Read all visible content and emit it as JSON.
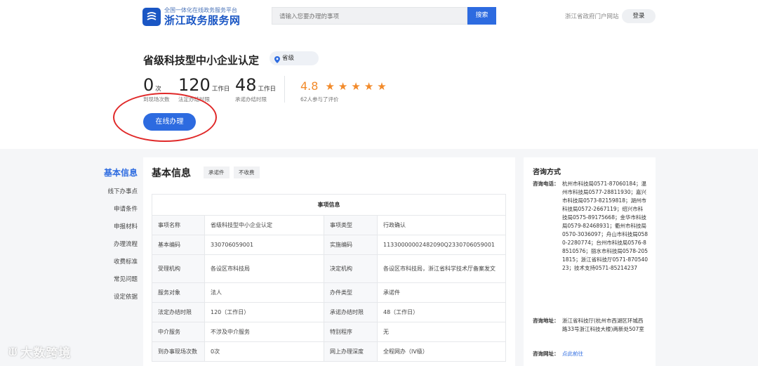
{
  "header": {
    "logo_subtitle": "全国一体化在线政务服务平台",
    "logo_title": "浙江政务服务网",
    "search_placeholder": "请输入您要办理的事项",
    "search_button": "搜索",
    "gov_portal_link": "浙江省政府门户网站",
    "login_button": "登录"
  },
  "item": {
    "title": "省级科技型中小企业认定",
    "level": "省级",
    "stats": [
      {
        "num": "0",
        "unit": "次",
        "label": "到现场次数"
      },
      {
        "num": "120",
        "unit": "工作日",
        "label": "法定办结时限"
      },
      {
        "num": "48",
        "unit": "工作日",
        "label": "承诺办结时限"
      }
    ],
    "rating": {
      "score": "4.8",
      "stars": 5,
      "count_label": "62人参与了评价"
    },
    "online_button": "在线办理"
  },
  "nav": {
    "items": [
      {
        "label": "基本信息",
        "active": true
      },
      {
        "label": "线下办事点"
      },
      {
        "label": "申请条件"
      },
      {
        "label": "申报材料"
      },
      {
        "label": "办理流程"
      },
      {
        "label": "收费标准"
      },
      {
        "label": "常见问题"
      },
      {
        "label": "设定依据"
      }
    ]
  },
  "basic_info": {
    "title": "基本信息",
    "tags": [
      "承诺件",
      "不收费"
    ],
    "table_header": "事项信息",
    "rows": [
      [
        "事项名称",
        "省级科技型中小企业认定",
        "事项类型",
        "行政确认"
      ],
      [
        "基本编码",
        "330706059001",
        "实施编码",
        "11330000002482090Q2330706059001"
      ],
      [
        "受理机构",
        "各设区市科技局",
        "决定机构",
        "各设区市科技局，浙江省科学技术厅备案发文"
      ],
      [
        "服务对象",
        "法人",
        "办件类型",
        "承诺件"
      ],
      [
        "法定办结时限",
        "120（工作日）",
        "承诺办结时限",
        "48（工作日）"
      ],
      [
        "中介服务",
        "不涉及中介服务",
        "特别程序",
        "无"
      ],
      [
        "到办事现场次数",
        "0次",
        "网上办理深度",
        "全程网办（IV级）"
      ]
    ]
  },
  "consult": {
    "title": "咨询方式",
    "phone_label": "咨询电话：",
    "phone_value": "杭州市科技局0571-87060184；温州市科技局0577-28811930；嘉兴市科技局0573-82159818；湖州市科技局0572-2667119；绍兴市科技局0575-89175668；金华市科技局0579-82468931；衢州市科技局0570-3036097；舟山市科技局0580-2280774；台州市科技局0576-88510576；丽水市科技局0578-2051815；浙江省科技厅0571-87054023；技术支持0571-85214237",
    "address_label": "咨询地址：",
    "address_value": "浙江省科技厅(杭州市西湖区环城西路33号浙江科技大楼)两新处507室",
    "website_label": "咨询网址：",
    "website_value": "点此前往"
  },
  "watermark": "大数跨境"
}
